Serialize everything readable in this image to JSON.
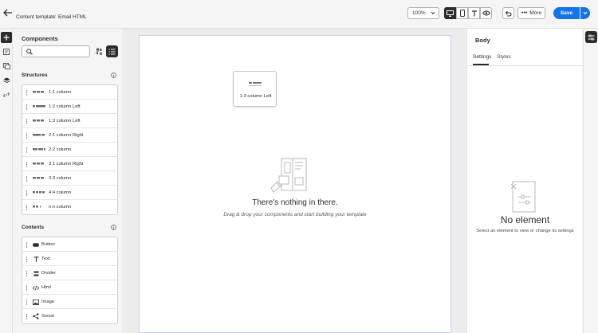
{
  "header": {
    "breadcrumb": [
      "Content template",
      "Email HTML"
    ],
    "breadcrumb_sep": "/",
    "zoom": "100%",
    "more_label": "More",
    "save_label": "Save"
  },
  "components": {
    "title": "Components",
    "search_placeholder": "",
    "structures_title": "Structures",
    "structures": [
      "1:1 column",
      "1:2 column Left",
      "1:3 column Left",
      "2:1 column Right",
      "2:2 column",
      "3:1 column Right",
      "3:3 column",
      "4:4 column",
      "n:n column"
    ],
    "contents_title": "Contents",
    "contents": [
      {
        "label": "Button",
        "icon": "button-icon"
      },
      {
        "label": "Text",
        "icon": "text-icon"
      },
      {
        "label": "Divider",
        "icon": "divider-icon"
      },
      {
        "label": "Html",
        "icon": "code-icon"
      },
      {
        "label": "Image",
        "icon": "image-icon"
      },
      {
        "label": "Social",
        "icon": "share-icon"
      }
    ]
  },
  "canvas": {
    "drag_label": "1:3 column Left",
    "empty_title": "There's nothing in there.",
    "empty_subtitle": "Drag & drop your components and start building your template"
  },
  "right_panel": {
    "title": "Body",
    "tabs": [
      "Settings",
      "Styles"
    ],
    "active_tab": "Settings",
    "empty_title": "No element",
    "empty_subtitle": "Select an element to view or change its settings"
  },
  "colors": {
    "accent": "#1473e6",
    "dark": "#2c2c2c"
  }
}
